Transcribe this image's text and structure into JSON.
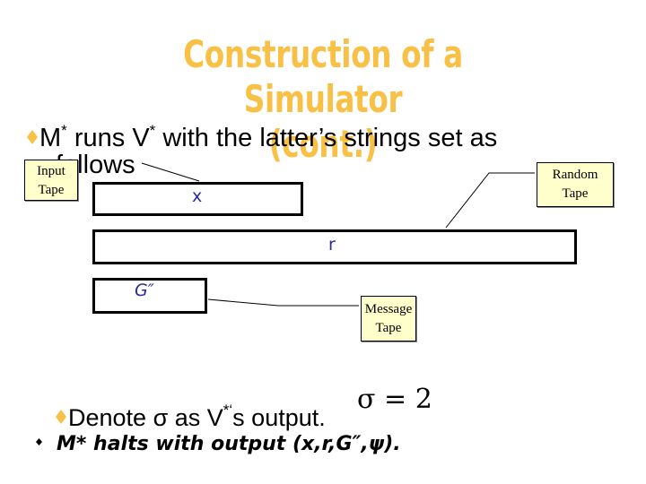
{
  "slide": {
    "title_line1": "Construction of a Simulator",
    "title_line2": "(cont.)",
    "accent_color": "#f9c046",
    "bullet1": {
      "part1": "M",
      "sup1": "*",
      "part2": " runs V",
      "sup2": "*",
      "part3": " with the latter’s strings set as",
      "line2": "follows"
    },
    "callouts": {
      "input_tape": [
        "Input",
        "Tape"
      ],
      "random_tape": [
        "Random",
        "Tape"
      ],
      "message_tape": [
        "Message",
        "Tape"
      ]
    },
    "tapes": {
      "input": "x",
      "random": "r",
      "message": "G″"
    },
    "bullet2": {
      "part1": "Denote σ as V",
      "sup": "*‘",
      "part2": "s output."
    },
    "formula": "σ = 2",
    "sub_bullet": "M* halts with output (x,r,G″,ψ)."
  }
}
